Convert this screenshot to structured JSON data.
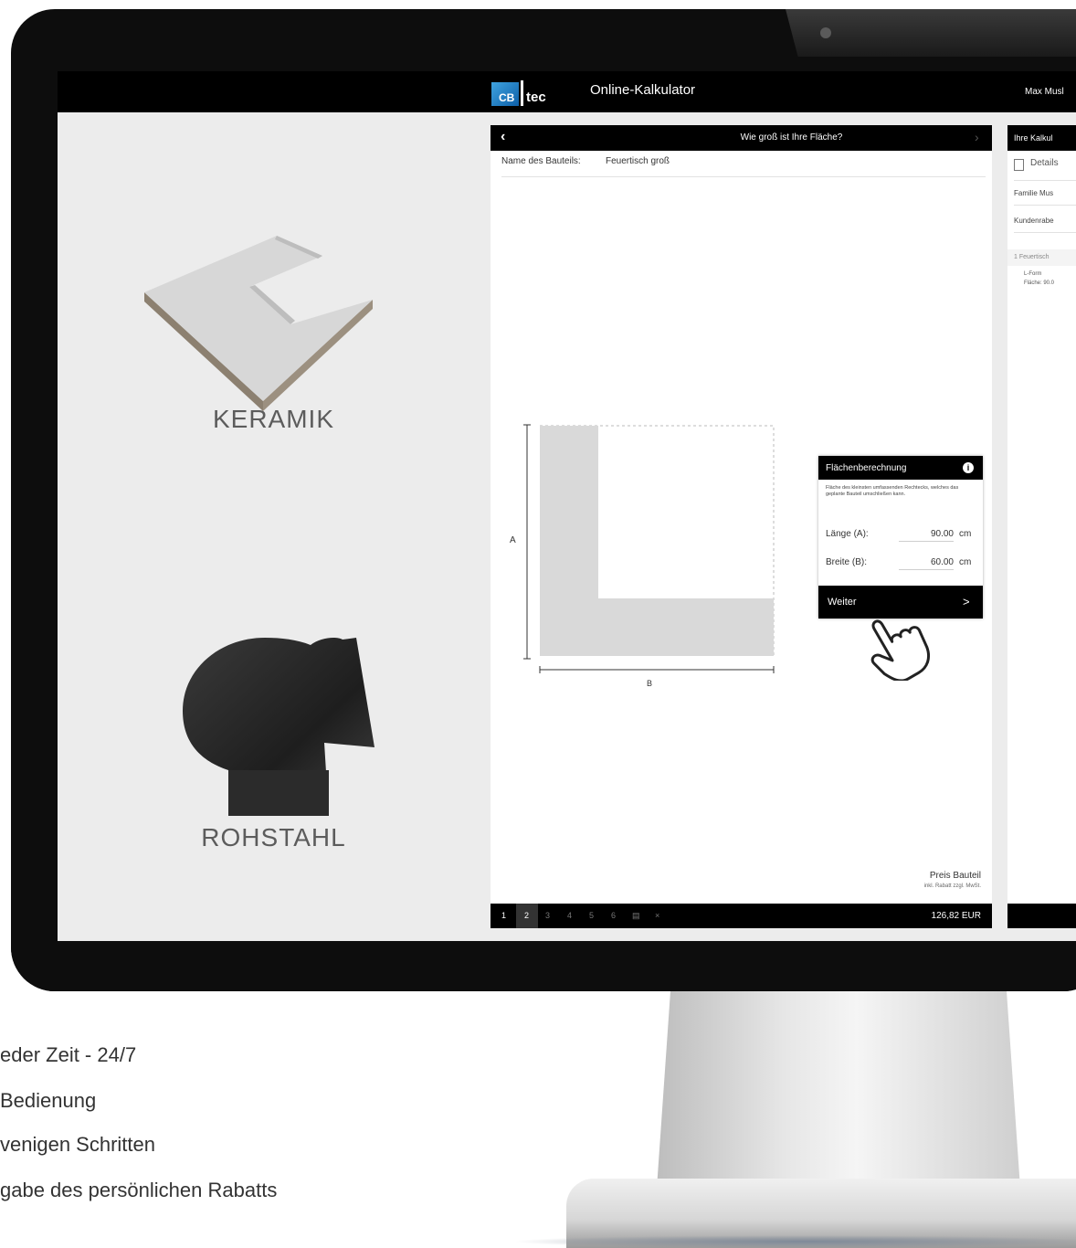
{
  "app": {
    "logo_cb": "CB",
    "logo_tec": "tec",
    "title": "Online-Kalkulator",
    "user": "Max Musl"
  },
  "materials": [
    {
      "label": "KERAMIK"
    },
    {
      "label": "ROHSTAHL"
    }
  ],
  "panel": {
    "title": "Wie groß ist Ihre Fläche?",
    "back_icon": "chevron-left-icon",
    "forward_icon": "chevron-right-icon",
    "name_label": "Name des Bauteils:",
    "name_value": "Feuertisch groß",
    "dim_a": "A",
    "dim_b": "B",
    "price_label": "Preis Bauteil",
    "price_sub": "inkl. Rabatt zzgl. MwSt.",
    "price_value": "126,82 EUR",
    "steps": [
      "1",
      "2",
      "3",
      "4",
      "5",
      "6",
      "▤",
      "×"
    ],
    "active_step": "2"
  },
  "area_calc": {
    "title": "Flächenberechnung",
    "info_icon": "i",
    "description": "Fläche des kleinsten umfassenden Rechtecks, welches das geplante Bauteil umschließen kann.",
    "laenge_label": "Länge (A):",
    "laenge_value": "90.00",
    "breite_label": "Breite (B):",
    "breite_value": "60.00",
    "unit": "cm",
    "weiter_label": "Weiter",
    "weiter_chev": ">"
  },
  "summary": {
    "title": "Ihre Kalkul",
    "details": "Details",
    "family": "Familie Mus",
    "discount": "Kundenrabe",
    "item": "1  Feuertisch",
    "item_form": "L-Form",
    "item_area": "Fläche: 90.0"
  },
  "features": [
    "eder Zeit - 24/7",
    "Bedienung",
    "venigen Schritten",
    "gabe des persönlichen Rabatts"
  ],
  "colors": {
    "accent": "#000000",
    "shape_fill": "#d9d9d9",
    "logo_blue": "#1f7fc9"
  }
}
